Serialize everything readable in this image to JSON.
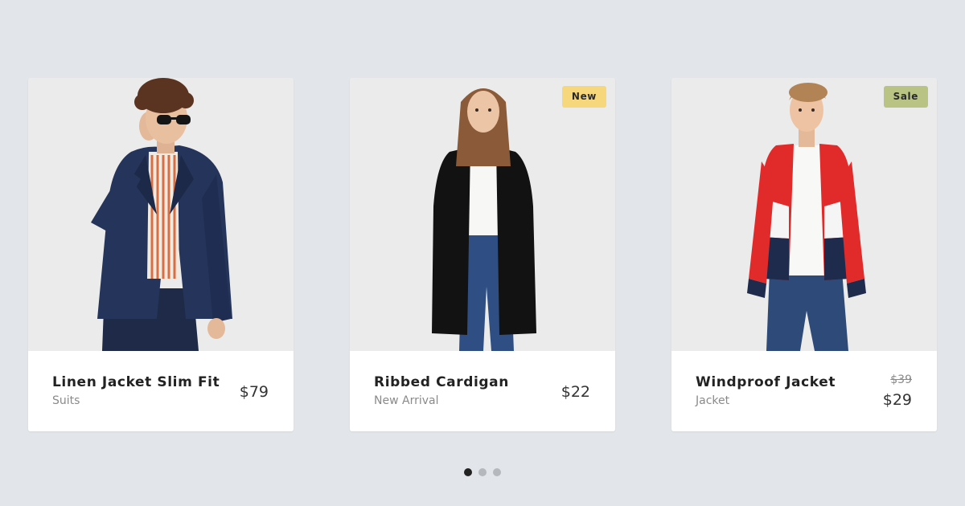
{
  "products": [
    {
      "name": "Linen Jacket Slim Fit",
      "category": "Suits",
      "price": "$79",
      "image": "model-navy-suit"
    },
    {
      "name": "Ribbed Cardigan",
      "category": "New Arrival",
      "price": "$22",
      "badge": "New",
      "image": "model-black-cardigan"
    },
    {
      "name": "Windproof Jacket",
      "category": "Jacket",
      "old_price": "$39",
      "price": "$29",
      "badge": "Sale",
      "image": "model-red-windbreaker"
    }
  ],
  "pagination": {
    "total": 3,
    "active": 1
  },
  "colors": {
    "background": "#e2e5e9",
    "badge_new": "#f6d77b",
    "badge_sale": "#b9c383",
    "dot_active": "#222222",
    "dot_inactive": "#b5b8bc"
  }
}
